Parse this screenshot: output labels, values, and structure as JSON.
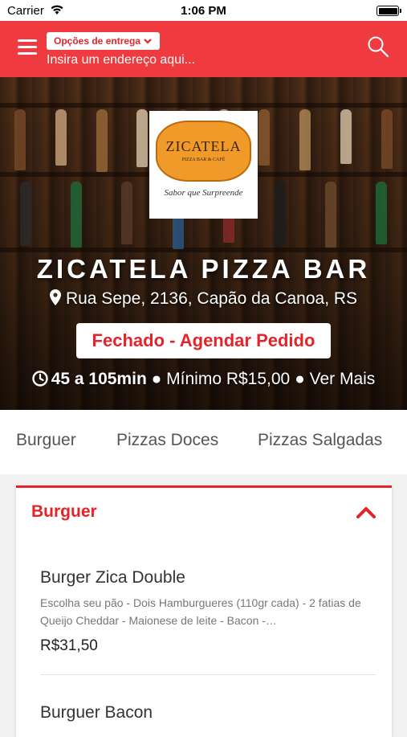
{
  "status_bar": {
    "carrier": "Carrier",
    "time": "1:06 PM"
  },
  "header": {
    "delivery_options_label": "Opções de entrega",
    "address_placeholder": "Insira um endereço aqui..."
  },
  "store": {
    "logo_name": "ZICATELA",
    "logo_subtitle": "PIZZA BAR & CAFÉ",
    "logo_slogan": "Sabor que Surpreende",
    "name": "ZICATELA PIZZA BAR",
    "address": "Rua Sepe, 2136, Capão da Canoa, RS",
    "status_button": "Fechado - Agendar Pedido",
    "delivery_time": "45 a 105min",
    "minimum": "Mínimo R$15,00",
    "more_label": "Ver Mais",
    "separator": "●"
  },
  "category_tabs": [
    "Burguer",
    "Pizzas Doces",
    "Pizzas Salgadas"
  ],
  "menu_section": {
    "title": "Burguer",
    "items": [
      {
        "name": "Burger Zica Double",
        "description": "Escolha seu pão - Dois Hamburgueres (110gr cada) - 2 fatias de Queijo Cheddar - Maionese de leite - Bacon -…",
        "price": "R$31,50"
      },
      {
        "name": "Burguer Bacon",
        "description": "",
        "price": ""
      }
    ]
  },
  "colors": {
    "brand_red": "#ef3b3f",
    "accent_red": "#e3242b"
  },
  "icons": {
    "menu": "hamburger-menu-icon",
    "search": "search-icon",
    "pin": "location-pin-icon",
    "clock": "clock-icon",
    "collapse": "chevron-up-icon",
    "dropdown": "chevron-down-icon"
  }
}
